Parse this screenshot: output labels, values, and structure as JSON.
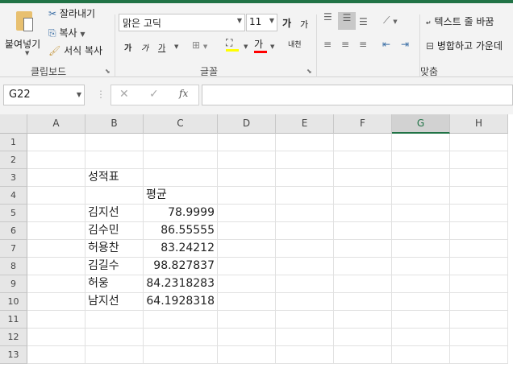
{
  "ribbon": {
    "clipboard": {
      "paste": "붙여넣기",
      "cut": "잘라내기",
      "copy": "복사",
      "format_painter": "서식 복사",
      "label": "클립보드"
    },
    "font": {
      "name": "맑은 고딕",
      "size": "11",
      "grow": "가",
      "shrink": "가",
      "bold": "가",
      "italic": "가",
      "underline": "가",
      "font_color": "가",
      "phonetic": "내천",
      "label": "글꼴",
      "fill_color": "#ffff00",
      "font_color_bar": "#ff0000"
    },
    "alignment": {
      "wrap_text": "텍스트 줄 바꿈",
      "merge_center": "병합하고 가운데",
      "label": "맞춤"
    }
  },
  "formula_bar": {
    "name_box": "G22",
    "fx": "fx",
    "formula": ""
  },
  "columns": [
    "A",
    "B",
    "C",
    "D",
    "E",
    "F",
    "G",
    "H"
  ],
  "active_column": "G",
  "rows": [
    "1",
    "2",
    "3",
    "4",
    "5",
    "6",
    "7",
    "8",
    "9",
    "10",
    "11",
    "12",
    "13"
  ],
  "cells": {
    "B3": "성적표",
    "C4": "평균",
    "B5": "김지선",
    "C5": "78.9999",
    "B6": "김수민",
    "C6": "86.55555",
    "B7": "허용찬",
    "C7": "83.24212",
    "B8": "김길수",
    "C8": "98.827837",
    "B9": "허웅",
    "C9": "84.2318283",
    "B10": "남지선",
    "C10": "64.1928318"
  }
}
